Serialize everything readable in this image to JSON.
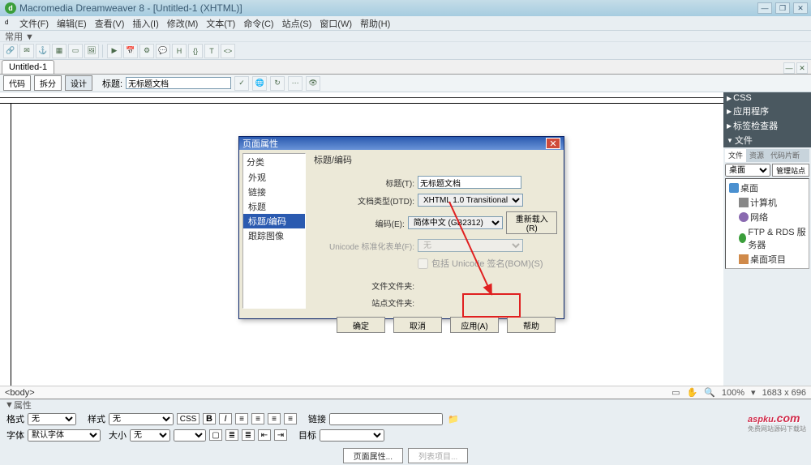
{
  "title_bar": {
    "text": "Macromedia Dreamweaver 8 - [Untitled-1 (XHTML)]"
  },
  "menu": [
    "文件(F)",
    "编辑(E)",
    "查看(V)",
    "插入(I)",
    "修改(M)",
    "文本(T)",
    "命令(C)",
    "站点(S)",
    "窗口(W)",
    "帮助(H)"
  ],
  "toolbar_label": "常用 ▼",
  "doc_tab": "Untitled-1",
  "view_buttons": {
    "code": "代码",
    "split": "拆分",
    "design": "设计"
  },
  "title_field": {
    "label": "标题:",
    "value": "无标题文档"
  },
  "right_panel": {
    "groups": [
      "CSS",
      "应用程序",
      "标签检查器",
      "文件"
    ],
    "file_tabs": [
      "文件",
      "资源",
      "代码片断"
    ],
    "site_select": "桌面",
    "manage_btn": "管理站点",
    "tree": [
      {
        "icon": "ico-desktop",
        "label": "桌面",
        "indent": 0
      },
      {
        "icon": "ico-comp",
        "label": "计算机",
        "indent": 1
      },
      {
        "icon": "ico-net",
        "label": "网络",
        "indent": 1
      },
      {
        "icon": "ico-ftp",
        "label": "FTP & RDS 服务器",
        "indent": 1
      },
      {
        "icon": "ico-proj",
        "label": "桌面项目",
        "indent": 1
      }
    ]
  },
  "tag_bar": {
    "path": "<body>",
    "zoom": "100%",
    "size": "1683 x 696"
  },
  "properties": {
    "head": "属性",
    "format_label": "格式",
    "format_value": "无",
    "style_label": "样式",
    "style_value": "无",
    "font_label": "字体",
    "font_value": "默认字体",
    "size_label": "大小",
    "size_value": "无",
    "css_btn": "CSS",
    "link_label": "链接",
    "target_label": "目标"
  },
  "bottom": {
    "page_props": "页面属性...",
    "list_items": "列表项目..."
  },
  "dialog": {
    "title": "页面属性",
    "cat_head": "分类",
    "categories": [
      "外观",
      "链接",
      "标题",
      "标题/编码",
      "跟踪图像"
    ],
    "selected_cat_index": 3,
    "section_title": "标题/编码",
    "rows": {
      "title": {
        "label": "标题(T):",
        "value": "无标题文档"
      },
      "doctype": {
        "label": "文档类型(DTD):",
        "value": "XHTML 1.0 Transitional"
      },
      "encoding": {
        "label": "编码(E):",
        "value": "简体中文 (GB2312)",
        "reload": "重新载入(R)"
      },
      "unicode_nf": {
        "label": "Unicode 标准化表单(F):",
        "value": "无"
      },
      "bom": {
        "label": "包括 Unicode 签名(BOM)(S)"
      },
      "file_folder": {
        "label": "文件文件夹:",
        "value": ""
      },
      "site_folder": {
        "label": "站点文件夹:",
        "value": ""
      }
    },
    "buttons": {
      "ok": "确定",
      "cancel": "取消",
      "apply": "应用(A)",
      "help": "帮助"
    }
  },
  "watermark": {
    "main": "aspku",
    "sub": ".com",
    "tagline": "免费网站源码下载站"
  }
}
